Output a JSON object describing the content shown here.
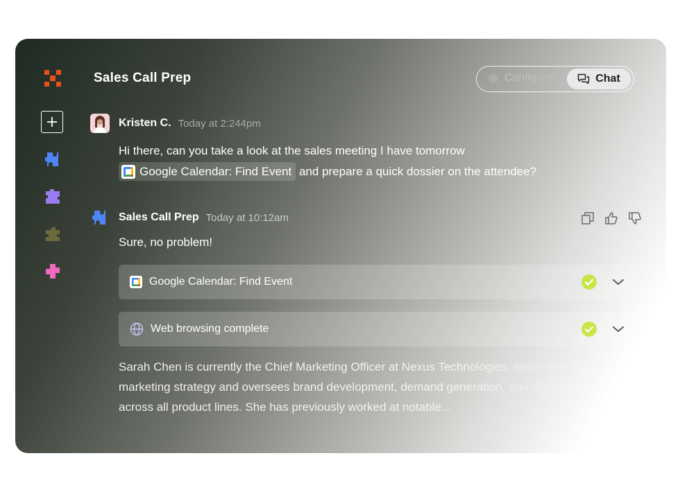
{
  "app": {
    "title": "Sales Call Prep"
  },
  "toggle": {
    "configure_label": "Configure",
    "chat_label": "Chat"
  },
  "colors": {
    "logo": "#e8501e",
    "puzzle_blue": "#4f86f7",
    "puzzle_purple": "#9b7cf0",
    "puzzle_olive": "#6d6a3c",
    "puzzle_pink": "#f06ac0",
    "check_green": "#c8e64a"
  },
  "icons": [
    "logo-icon",
    "plus-icon",
    "puzzle-icon",
    "settings-icon",
    "chat-icon",
    "copy-icon",
    "thumbs-up-icon",
    "thumbs-down-icon",
    "calendar-icon",
    "globe-icon",
    "check-icon",
    "chevron-down-icon"
  ],
  "messages": {
    "user": {
      "name": "Kristen C.",
      "time": "Today at 2:244pm",
      "text_before": "Hi there, can you take a look at the sales meeting I have tomorrow",
      "chip": "Google Calendar: Find Event",
      "text_after": "and prepare a quick dossier on the attendee?"
    },
    "bot": {
      "name": "Sales Call Prep",
      "time": "Today at 10:12am",
      "greeting": "Sure, no problem!",
      "tools": [
        {
          "label": "Google Calendar: Find Event",
          "status": "complete"
        },
        {
          "label": "Web browsing complete",
          "status": "complete"
        }
      ],
      "summary": "Sarah Chen is currently the Chief Marketing Officer at Nexus Technologies, where she leads global marketing strategy and oversees brand development, demand generation, and digital campaigns across all product lines. She has previously worked at notable..."
    }
  }
}
